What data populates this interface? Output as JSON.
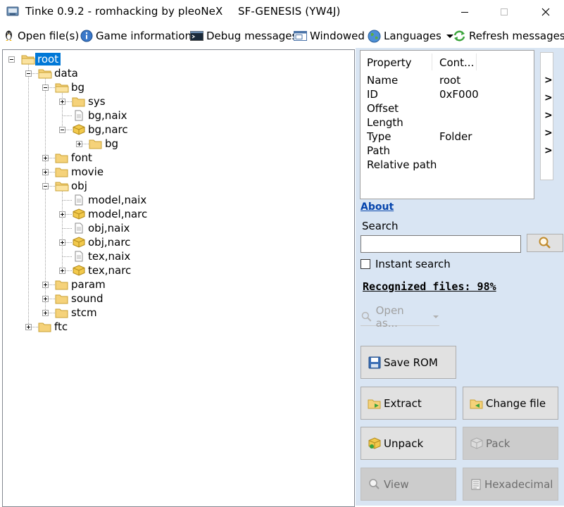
{
  "window": {
    "title": "Tinke 0.9.2 - romhacking by pleoNeX",
    "game": "SF-GENESIS (YW4J)",
    "controls": {
      "minimize": "minimize",
      "maximize": "maximize",
      "close": "close"
    }
  },
  "toolbar": {
    "open_files": "Open file(s)",
    "game_info": "Game information",
    "debug": "Debug messages",
    "windowed": "Windowed",
    "languages": "Languages",
    "refresh": "Refresh messages"
  },
  "tree": {
    "root": "root",
    "data": "data",
    "bg": "bg",
    "sys": "sys",
    "bg_naix": "bg,naix",
    "bg_narc": "bg,narc",
    "bg_inner": "bg",
    "font": "font",
    "movie": "movie",
    "obj": "obj",
    "model_naix": "model,naix",
    "model_narc": "model,narc",
    "obj_naix": "obj,naix",
    "obj_narc": "obj,narc",
    "tex_naix": "tex,naix",
    "tex_narc": "tex,narc",
    "param": "param",
    "sound": "sound",
    "stcm": "stcm",
    "ftc": "ftc"
  },
  "properties": {
    "header_property": "Property",
    "header_content": "Cont...",
    "rows": [
      {
        "key": "Name",
        "value": "root"
      },
      {
        "key": "ID",
        "value": "0xF000"
      },
      {
        "key": "Offset",
        "value": ""
      },
      {
        "key": "Length",
        "value": ""
      },
      {
        "key": "Type",
        "value": "Folder"
      },
      {
        "key": "Path",
        "value": ""
      },
      {
        "key": "Relative path",
        "value": ""
      }
    ],
    "arrows": [
      ">",
      ">",
      ">",
      ">",
      ">"
    ]
  },
  "side": {
    "about": "About",
    "search_label": "Search",
    "search_value": "",
    "instant_search": "Instant search",
    "recognized": "Recognized files: 98%",
    "open_as": "Open as..."
  },
  "buttons": {
    "save_rom": "Save ROM",
    "extract": "Extract",
    "change_file": "Change file",
    "unpack": "Unpack",
    "pack": "Pack",
    "view": "View",
    "hexadecimal": "Hexadecimal"
  },
  "colors": {
    "selection": "#0078d7",
    "panel": "#d9e5f3",
    "link": "#0645ad"
  }
}
